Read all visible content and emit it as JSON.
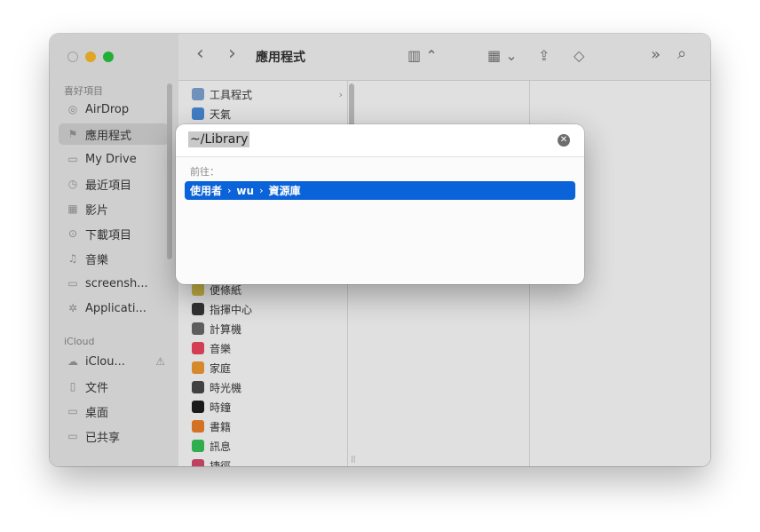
{
  "window": {
    "title": "應用程式"
  },
  "sidebar": {
    "sections": [
      {
        "label": "喜好項目"
      },
      {
        "label": "iCloud"
      }
    ],
    "favorites": [
      {
        "label": "AirDrop",
        "icon": "airdrop-icon",
        "glyph": "◎"
      },
      {
        "label": "應用程式",
        "icon": "applications-icon",
        "glyph": "⚑",
        "selected": true
      },
      {
        "label": "My Drive",
        "icon": "folder-icon",
        "glyph": "▭"
      },
      {
        "label": "最近項目",
        "icon": "clock-icon",
        "glyph": "◷"
      },
      {
        "label": "影片",
        "icon": "film-icon",
        "glyph": "▦"
      },
      {
        "label": "下載項目",
        "icon": "download-icon",
        "glyph": "⊙"
      },
      {
        "label": "音樂",
        "icon": "music-icon",
        "glyph": "♫"
      },
      {
        "label": "screensh...",
        "icon": "folder-icon",
        "glyph": "▭"
      },
      {
        "label": "Applicati...",
        "icon": "gear-icon",
        "glyph": "✲"
      }
    ],
    "icloud": [
      {
        "label": "iClou...",
        "icon": "cloud-icon",
        "glyph": "☁",
        "warning": "⚠"
      },
      {
        "label": "文件",
        "icon": "document-icon",
        "glyph": "▯"
      },
      {
        "label": "桌面",
        "icon": "desktop-icon",
        "glyph": "▭"
      },
      {
        "label": "已共享",
        "icon": "shared-folder-icon",
        "glyph": "▭"
      }
    ]
  },
  "toolbar": {
    "back_glyph": "‹",
    "forward_glyph": "›",
    "view_glyph": "▥ ⌃",
    "group_glyph": "▦ ⌄",
    "share_glyph": "⇪",
    "tag_glyph": "◇",
    "more_glyph": "»",
    "search_glyph": "⌕"
  },
  "apps": [
    {
      "label": "工具程式",
      "icon": "utilities-folder-icon",
      "color": "#7fa6d6",
      "chevron": "›"
    },
    {
      "label": "天氣",
      "icon": "weather-icon",
      "color": "#4b8fe0"
    },
    {
      "label": "便條紙",
      "icon": "stickies-icon",
      "color": "#d9c24a"
    },
    {
      "label": "指揮中心",
      "icon": "mission-control-icon",
      "color": "#3a3a3a"
    },
    {
      "label": "計算機",
      "icon": "calculator-icon",
      "color": "#6c6c6c"
    },
    {
      "label": "音樂",
      "icon": "music-app-icon",
      "color": "#f0485f"
    },
    {
      "label": "家庭",
      "icon": "home-app-icon",
      "color": "#f39c33"
    },
    {
      "label": "時光機",
      "icon": "time-machine-icon",
      "color": "#4a4a4a"
    },
    {
      "label": "時鐘",
      "icon": "clock-app-icon",
      "color": "#1e1e1e"
    },
    {
      "label": "書籍",
      "icon": "books-icon",
      "color": "#f2822a"
    },
    {
      "label": "訊息",
      "icon": "messages-icon",
      "color": "#35c759"
    },
    {
      "label": "捷徑",
      "icon": "shortcuts-icon",
      "color": "#d94a6a"
    }
  ],
  "goto": {
    "input_value": "~/Library",
    "clear_glyph": "✕",
    "section_label": "前往：",
    "result": {
      "parts": [
        "使用者",
        "wu",
        "資源庫"
      ],
      "separator": "›"
    }
  }
}
